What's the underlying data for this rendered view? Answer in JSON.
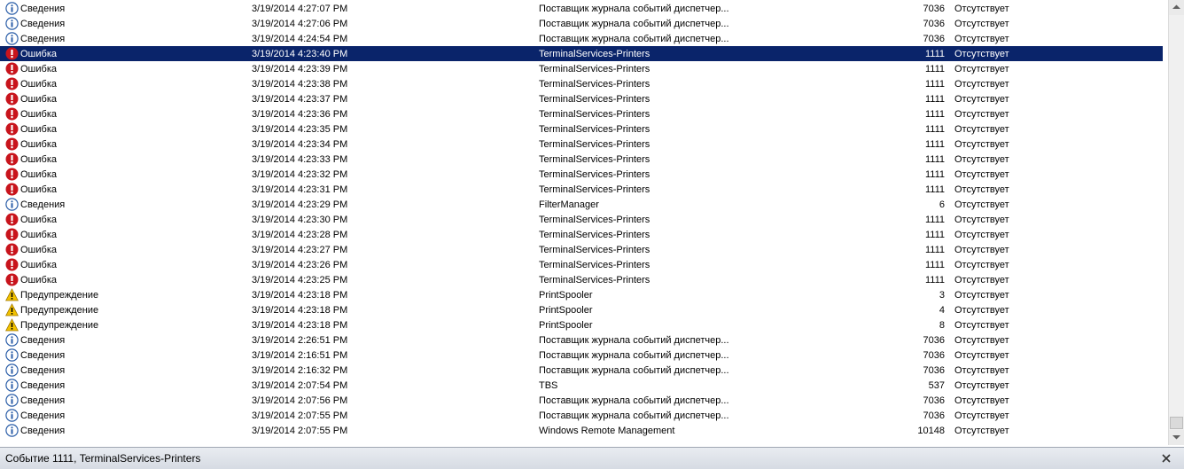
{
  "window": {
    "statusbar_title": "Событие 1111, TerminalServices-Printers"
  },
  "colors": {
    "selection": "#0a246a",
    "info": "#2b5ea8",
    "error": "#c8141c",
    "warning": "#f2c200"
  },
  "events": [
    {
      "level": "Сведения",
      "icon": "info-icon",
      "date": "3/19/2014 4:27:07 PM",
      "source": "Поставщик журнала событий диспетчер...",
      "id": "7036",
      "task": "Отсутствует"
    },
    {
      "level": "Сведения",
      "icon": "info-icon",
      "date": "3/19/2014 4:27:06 PM",
      "source": "Поставщик журнала событий диспетчер...",
      "id": "7036",
      "task": "Отсутствует"
    },
    {
      "level": "Сведения",
      "icon": "info-icon",
      "date": "3/19/2014 4:24:54 PM",
      "source": "Поставщик журнала событий диспетчер...",
      "id": "7036",
      "task": "Отсутствует"
    },
    {
      "level": "Ошибка",
      "icon": "error-icon",
      "date": "3/19/2014 4:23:40 PM",
      "source": "TerminalServices-Printers",
      "id": "1111",
      "task": "Отсутствует",
      "selected": true
    },
    {
      "level": "Ошибка",
      "icon": "error-icon",
      "date": "3/19/2014 4:23:39 PM",
      "source": "TerminalServices-Printers",
      "id": "1111",
      "task": "Отсутствует"
    },
    {
      "level": "Ошибка",
      "icon": "error-icon",
      "date": "3/19/2014 4:23:38 PM",
      "source": "TerminalServices-Printers",
      "id": "1111",
      "task": "Отсутствует"
    },
    {
      "level": "Ошибка",
      "icon": "error-icon",
      "date": "3/19/2014 4:23:37 PM",
      "source": "TerminalServices-Printers",
      "id": "1111",
      "task": "Отсутствует"
    },
    {
      "level": "Ошибка",
      "icon": "error-icon",
      "date": "3/19/2014 4:23:36 PM",
      "source": "TerminalServices-Printers",
      "id": "1111",
      "task": "Отсутствует"
    },
    {
      "level": "Ошибка",
      "icon": "error-icon",
      "date": "3/19/2014 4:23:35 PM",
      "source": "TerminalServices-Printers",
      "id": "1111",
      "task": "Отсутствует"
    },
    {
      "level": "Ошибка",
      "icon": "error-icon",
      "date": "3/19/2014 4:23:34 PM",
      "source": "TerminalServices-Printers",
      "id": "1111",
      "task": "Отсутствует"
    },
    {
      "level": "Ошибка",
      "icon": "error-icon",
      "date": "3/19/2014 4:23:33 PM",
      "source": "TerminalServices-Printers",
      "id": "1111",
      "task": "Отсутствует"
    },
    {
      "level": "Ошибка",
      "icon": "error-icon",
      "date": "3/19/2014 4:23:32 PM",
      "source": "TerminalServices-Printers",
      "id": "1111",
      "task": "Отсутствует"
    },
    {
      "level": "Ошибка",
      "icon": "error-icon",
      "date": "3/19/2014 4:23:31 PM",
      "source": "TerminalServices-Printers",
      "id": "1111",
      "task": "Отсутствует"
    },
    {
      "level": "Сведения",
      "icon": "info-icon",
      "date": "3/19/2014 4:23:29 PM",
      "source": "FilterManager",
      "id": "6",
      "task": "Отсутствует"
    },
    {
      "level": "Ошибка",
      "icon": "error-icon",
      "date": "3/19/2014 4:23:30 PM",
      "source": "TerminalServices-Printers",
      "id": "1111",
      "task": "Отсутствует"
    },
    {
      "level": "Ошибка",
      "icon": "error-icon",
      "date": "3/19/2014 4:23:28 PM",
      "source": "TerminalServices-Printers",
      "id": "1111",
      "task": "Отсутствует"
    },
    {
      "level": "Ошибка",
      "icon": "error-icon",
      "date": "3/19/2014 4:23:27 PM",
      "source": "TerminalServices-Printers",
      "id": "1111",
      "task": "Отсутствует"
    },
    {
      "level": "Ошибка",
      "icon": "error-icon",
      "date": "3/19/2014 4:23:26 PM",
      "source": "TerminalServices-Printers",
      "id": "1111",
      "task": "Отсутствует"
    },
    {
      "level": "Ошибка",
      "icon": "error-icon",
      "date": "3/19/2014 4:23:25 PM",
      "source": "TerminalServices-Printers",
      "id": "1111",
      "task": "Отсутствует"
    },
    {
      "level": "Предупреждение",
      "icon": "warning-icon",
      "date": "3/19/2014 4:23:18 PM",
      "source": "PrintSpooler",
      "id": "3",
      "task": "Отсутствует"
    },
    {
      "level": "Предупреждение",
      "icon": "warning-icon",
      "date": "3/19/2014 4:23:18 PM",
      "source": "PrintSpooler",
      "id": "4",
      "task": "Отсутствует"
    },
    {
      "level": "Предупреждение",
      "icon": "warning-icon",
      "date": "3/19/2014 4:23:18 PM",
      "source": "PrintSpooler",
      "id": "8",
      "task": "Отсутствует"
    },
    {
      "level": "Сведения",
      "icon": "info-icon",
      "date": "3/19/2014 2:26:51 PM",
      "source": "Поставщик журнала событий диспетчер...",
      "id": "7036",
      "task": "Отсутствует"
    },
    {
      "level": "Сведения",
      "icon": "info-icon",
      "date": "3/19/2014 2:16:51 PM",
      "source": "Поставщик журнала событий диспетчер...",
      "id": "7036",
      "task": "Отсутствует"
    },
    {
      "level": "Сведения",
      "icon": "info-icon",
      "date": "3/19/2014 2:16:32 PM",
      "source": "Поставщик журнала событий диспетчер...",
      "id": "7036",
      "task": "Отсутствует"
    },
    {
      "level": "Сведения",
      "icon": "info-icon",
      "date": "3/19/2014 2:07:54 PM",
      "source": "TBS",
      "id": "537",
      "task": "Отсутствует"
    },
    {
      "level": "Сведения",
      "icon": "info-icon",
      "date": "3/19/2014 2:07:56 PM",
      "source": "Поставщик журнала событий диспетчер...",
      "id": "7036",
      "task": "Отсутствует"
    },
    {
      "level": "Сведения",
      "icon": "info-icon",
      "date": "3/19/2014 2:07:55 PM",
      "source": "Поставщик журнала событий диспетчер...",
      "id": "7036",
      "task": "Отсутствует"
    },
    {
      "level": "Сведения",
      "icon": "info-icon",
      "date": "3/19/2014 2:07:55 PM",
      "source": "Windows Remote Management",
      "id": "10148",
      "task": "Отсутствует"
    }
  ]
}
